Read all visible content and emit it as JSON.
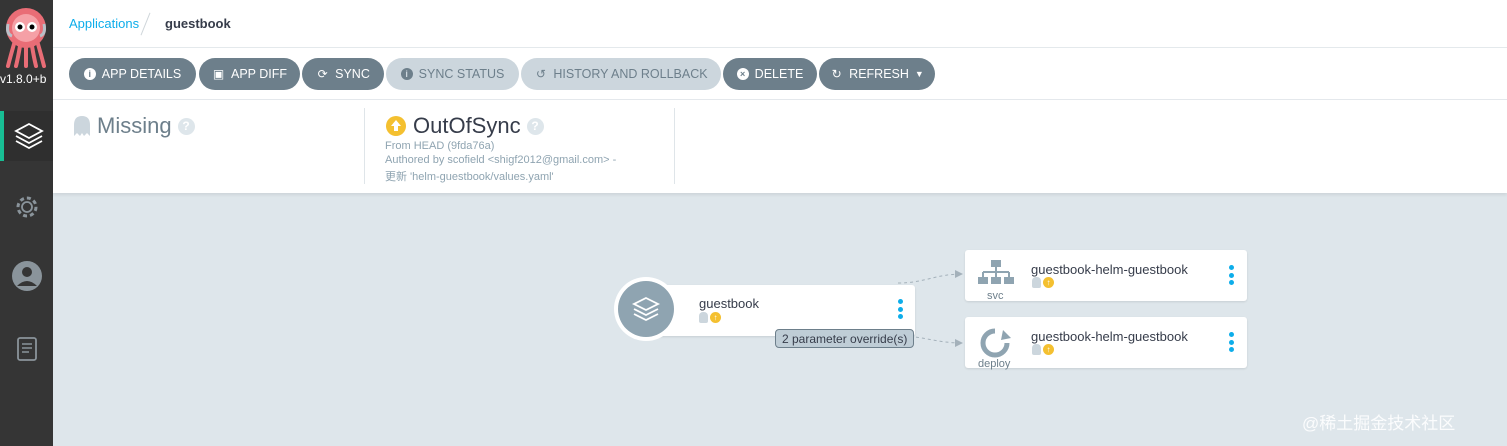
{
  "sidebar": {
    "version": "v1.8.0+b",
    "items": [
      {
        "icon": "layers-icon"
      },
      {
        "icon": "gear-icon"
      },
      {
        "icon": "user-icon"
      },
      {
        "icon": "docs-icon"
      }
    ]
  },
  "breadcrumb": {
    "link": "Applications",
    "current": "guestbook"
  },
  "toolbar": {
    "app_details": "APP DETAILS",
    "app_diff": "APP DIFF",
    "sync": "SYNC",
    "sync_status": "SYNC STATUS",
    "history": "HISTORY AND ROLLBACK",
    "delete": "DELETE",
    "refresh": "REFRESH"
  },
  "health": {
    "label": "Missing",
    "icon": "ghost-icon"
  },
  "sync": {
    "label": "OutOfSync",
    "icon": "arrow-up-circle-icon",
    "from": "From HEAD (9fda76a)",
    "authored": "Authored by scofield <shigf2012@gmail.com> -",
    "message": "更新 'helm-guestbook/values.yaml'"
  },
  "graph": {
    "app_node": {
      "name": "guestbook"
    },
    "edge_label": "2 parameter override(s)",
    "resources": [
      {
        "name": "guestbook-helm-guestbook",
        "kind": "svc"
      },
      {
        "name": "guestbook-helm-guestbook",
        "kind": "deploy"
      }
    ]
  },
  "colors": {
    "accent": "#0dadea",
    "button": "#6d7f8b",
    "button_disabled": "#ccd6dd",
    "out_of_sync": "#f4c030",
    "sidebar": "#353535",
    "canvas": "#dee6eb"
  },
  "watermark": "@稀土掘金技术社区"
}
